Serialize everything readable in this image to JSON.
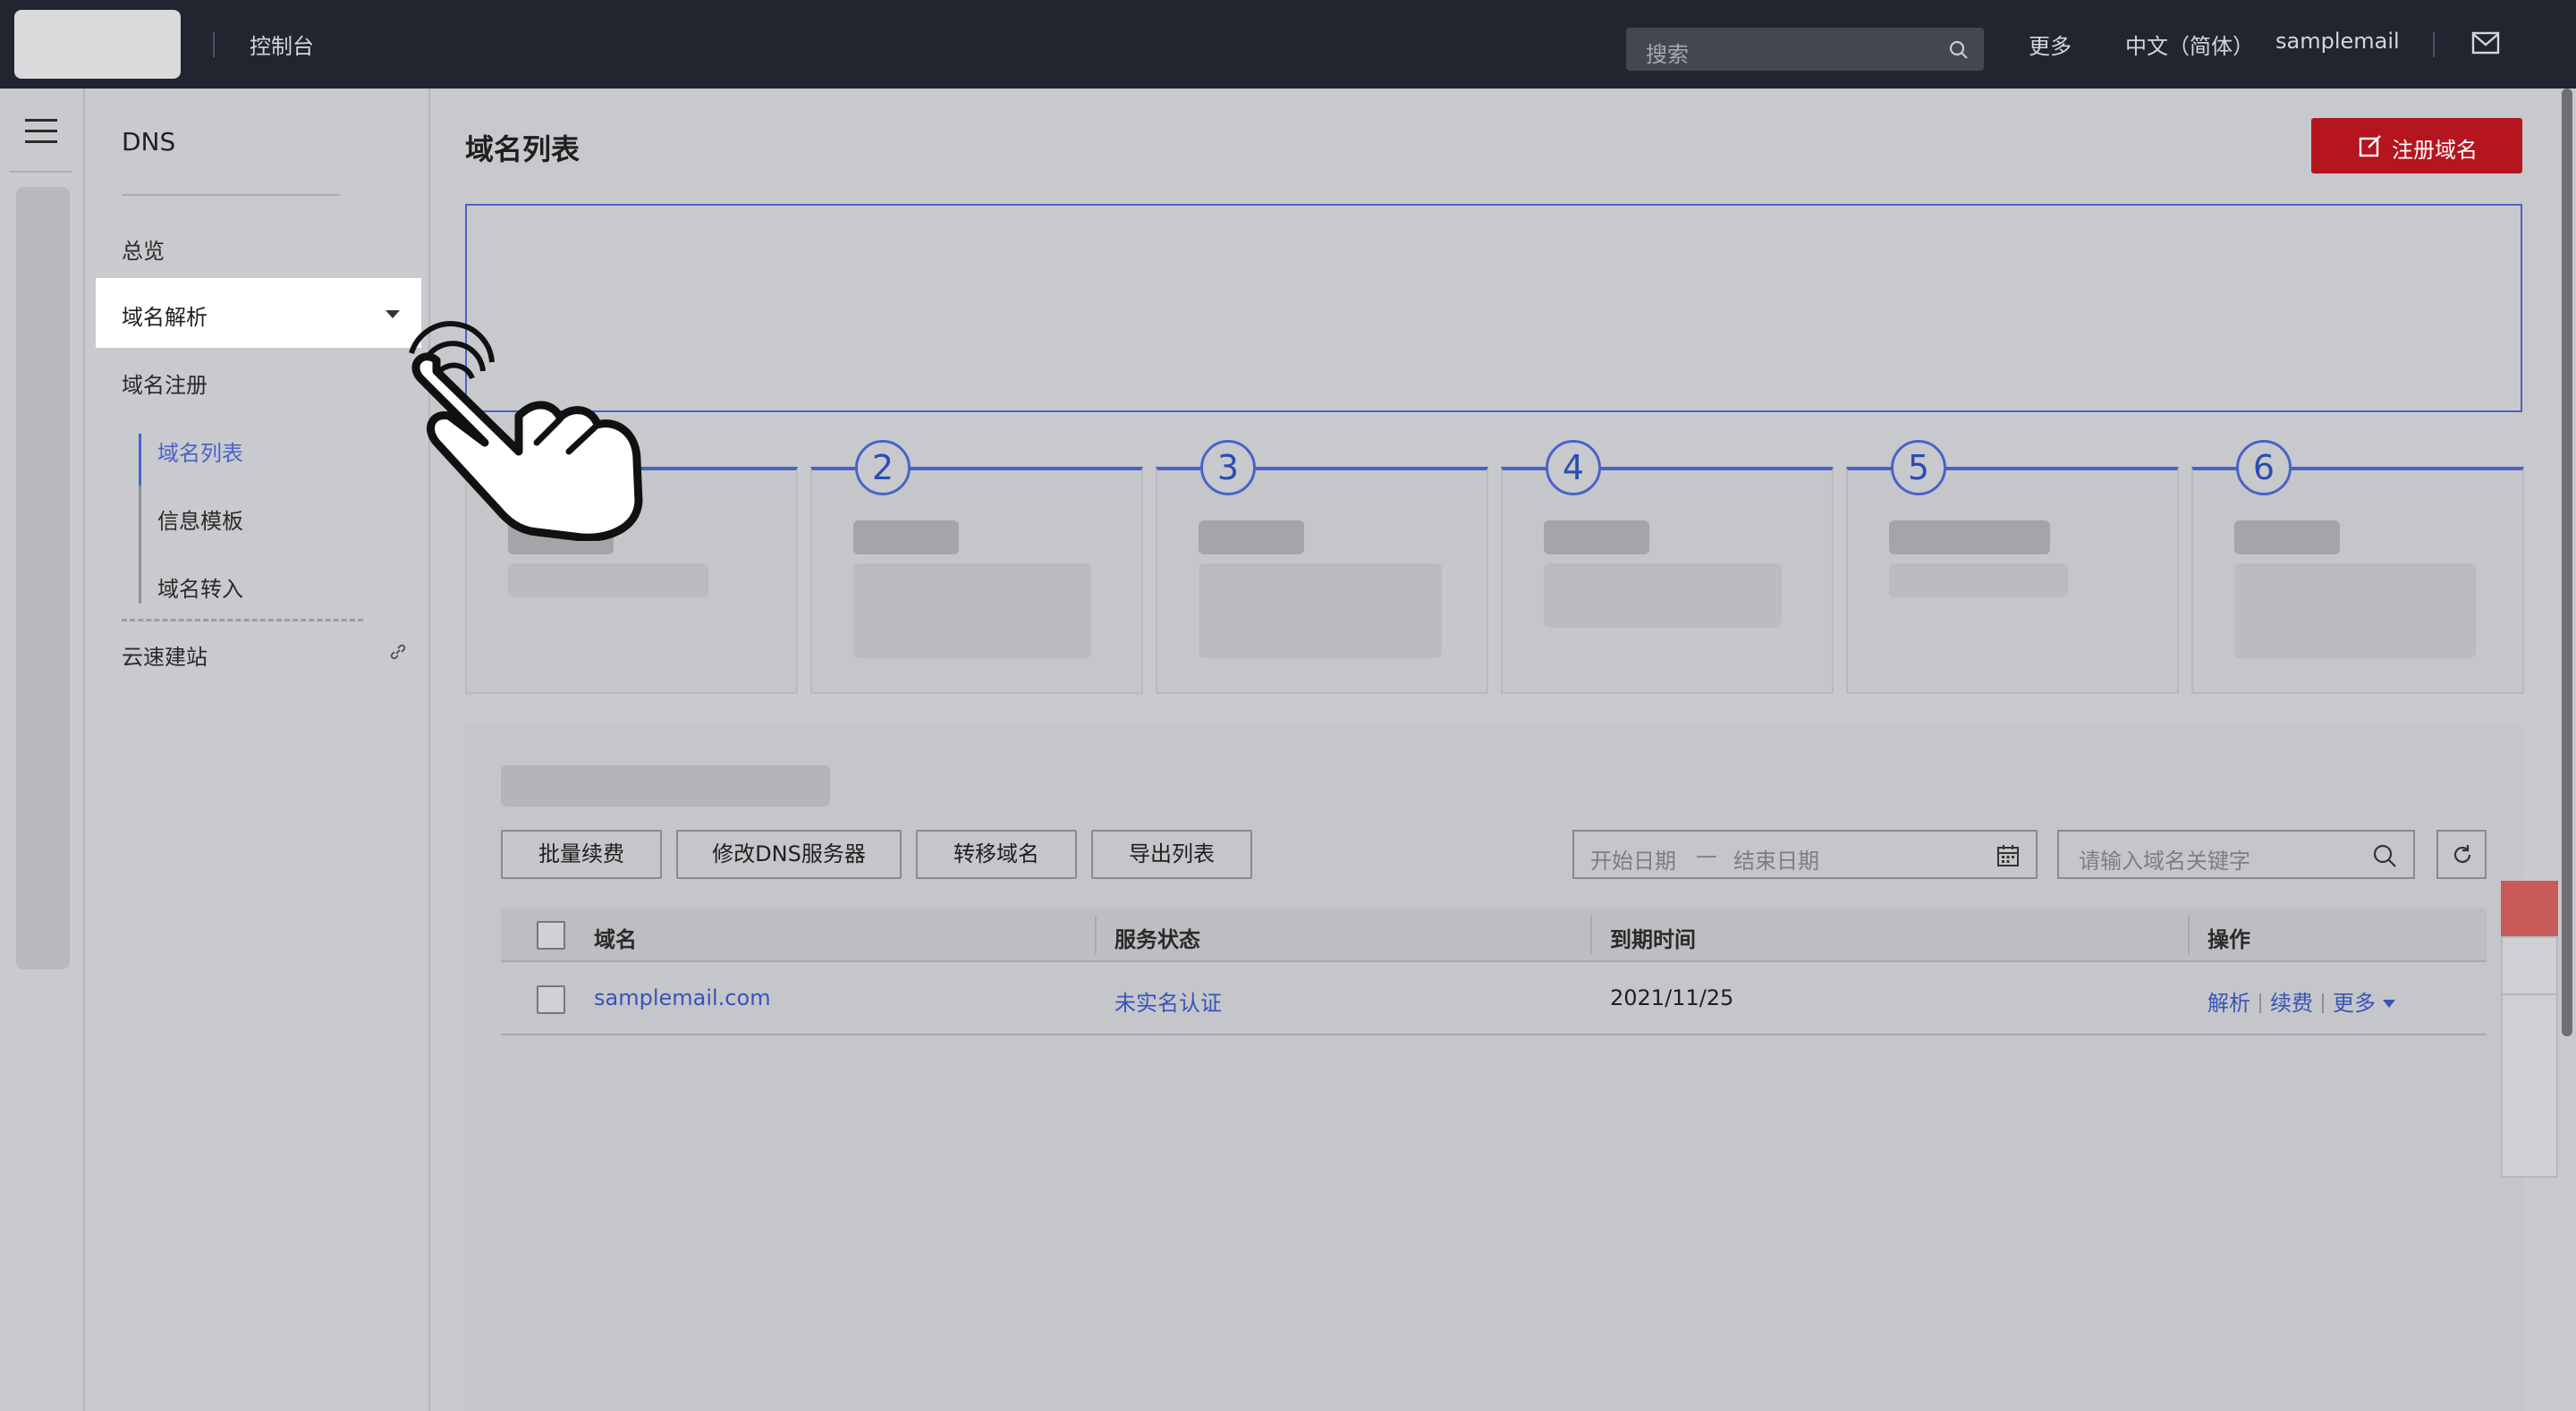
{
  "topbar": {
    "console": "控制台",
    "search_placeholder": "搜索",
    "more": "更多",
    "language": "中文（简体）",
    "user": "samplemail"
  },
  "sidebar": {
    "title": "DNS",
    "items": [
      {
        "label": "总览"
      },
      {
        "label": "域名解析"
      },
      {
        "label": "域名注册"
      },
      {
        "label": "云速建站"
      }
    ],
    "sub_items": [
      {
        "label": "域名列表"
      },
      {
        "label": "信息模板"
      },
      {
        "label": "域名转入"
      }
    ]
  },
  "main": {
    "title": "域名列表",
    "register_button": "注册域名",
    "steps": [
      "2",
      "3",
      "4",
      "5",
      "6"
    ],
    "toolbar": {
      "batch_renew": "批量续费",
      "modify_dns": "修改DNS服务器",
      "transfer": "转移域名",
      "export": "导出列表",
      "start_date": "开始日期",
      "dash": "—",
      "end_date": "结束日期",
      "keyword_placeholder": "请输入域名关键字"
    },
    "table": {
      "headers": [
        "域名",
        "服务状态",
        "到期时间",
        "操作"
      ],
      "rows": [
        {
          "domain": "samplemail.com",
          "status": "未实名认证",
          "expiry": "2021/11/25",
          "ops": [
            "解析",
            "续费",
            "更多"
          ]
        }
      ]
    }
  },
  "colors": {
    "accent": "#4a63c7",
    "brand_red": "#b4151f",
    "topbar": "#222530"
  }
}
